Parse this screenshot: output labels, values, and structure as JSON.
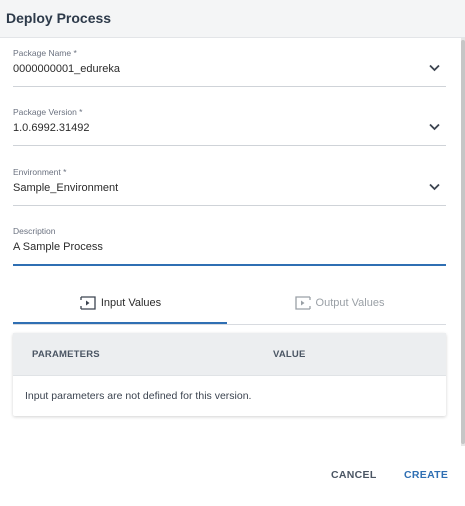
{
  "dialog": {
    "title": "Deploy Process"
  },
  "fields": {
    "package_name": {
      "label": "Package Name *",
      "value": "0000000001_edureka"
    },
    "package_version": {
      "label": "Package Version *",
      "value": "1.0.6992.31492"
    },
    "environment": {
      "label": "Environment *",
      "value": "Sample_Environment"
    },
    "description": {
      "label": "Description",
      "value": "A Sample Process"
    }
  },
  "tabs": [
    {
      "label": "Input Values",
      "selected": true,
      "icon": "input-values-icon"
    },
    {
      "label": "Output Values",
      "selected": false,
      "icon": "output-values-icon"
    }
  ],
  "parameters_table": {
    "columns": [
      "PARAMETERS",
      "VALUE"
    ],
    "empty_message": "Input parameters are not defined for this version."
  },
  "actions": {
    "cancel": "CANCEL",
    "create": "CREATE"
  },
  "colors": {
    "accent": "#2f6fb3",
    "header_bg": "#f4f5f6",
    "table_head_bg": "#eceef0"
  }
}
